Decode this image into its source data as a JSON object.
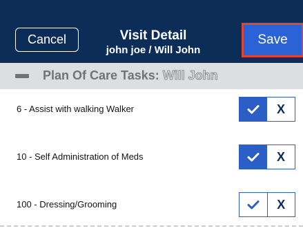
{
  "navbar": {
    "cancel_label": "Cancel",
    "title": "Visit Detail",
    "subtitle": "john joe / Will John",
    "save_label": "Save",
    "background_color": "#0c2d58",
    "save_color": "#2b63d6",
    "save_highlight_color": "#e04436"
  },
  "section": {
    "label": "Plan Of Care Tasks:",
    "patient": "Will John",
    "collapse_icon": "minus-icon"
  },
  "tasks": [
    {
      "label": "6 - Assist with walking Walker",
      "state": "checked",
      "check_icon": "checkmark-icon",
      "cross_label": "X"
    },
    {
      "label": "10 - Self Administration of Meds",
      "state": "checked",
      "check_icon": "checkmark-icon",
      "cross_label": "X"
    },
    {
      "label": "100 - Dressing/Grooming",
      "state": "unset",
      "check_icon": "checkmark-icon",
      "cross_label": "X"
    }
  ]
}
